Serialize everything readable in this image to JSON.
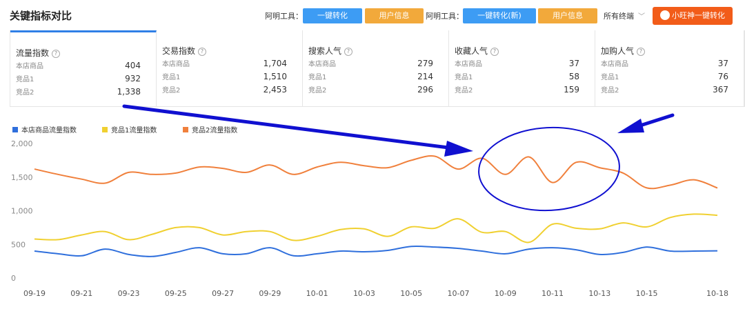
{
  "header": {
    "title": "关键指标对比",
    "tool_label_1": "阿明工具：",
    "btn_convert": "一键转化",
    "btn_user_info_1": "用户信息",
    "tool_label_2": "阿明工具：",
    "btn_convert_new": "一键转化(新)",
    "btn_user_info_2": "用户信息",
    "terminal_select": "所有终端",
    "btn_wangshen": "小旺神一键转化"
  },
  "cards": [
    {
      "title": "流量指数",
      "rows": [
        {
          "label": "本店商品",
          "value": "404"
        },
        {
          "label": "竞品1",
          "value": "932"
        },
        {
          "label": "竞品2",
          "value": "1,338"
        }
      ]
    },
    {
      "title": "交易指数",
      "rows": [
        {
          "label": "本店商品",
          "value": "1,704"
        },
        {
          "label": "竞品1",
          "value": "1,510"
        },
        {
          "label": "竞品2",
          "value": "2,453"
        }
      ]
    },
    {
      "title": "搜索人气",
      "rows": [
        {
          "label": "本店商品",
          "value": "279"
        },
        {
          "label": "竞品1",
          "value": "214"
        },
        {
          "label": "竞品2",
          "value": "296"
        }
      ]
    },
    {
      "title": "收藏人气",
      "rows": [
        {
          "label": "本店商品",
          "value": "37"
        },
        {
          "label": "竞品1",
          "value": "58"
        },
        {
          "label": "竞品2",
          "value": "159"
        }
      ]
    },
    {
      "title": "加购人气",
      "rows": [
        {
          "label": "本店商品",
          "value": "37"
        },
        {
          "label": "竞品1",
          "value": "76"
        },
        {
          "label": "竞品2",
          "value": "367"
        }
      ]
    }
  ],
  "colors": {
    "accent": "#2f7fe6",
    "btn_blue": "#3d9cf4",
    "btn_orange": "#f2a93b",
    "btn_red": "#f25c19",
    "annotation": "#1010d0"
  },
  "icons": {
    "help": "question-circle-icon",
    "wangshen": "wangwang-icon",
    "dropdown": "chevron-down-icon"
  },
  "chart_data": {
    "type": "line",
    "legend_position": "top-left",
    "grid": false,
    "ylim": [
      0,
      2000
    ],
    "yticks": [
      "0",
      "500",
      "1,000",
      "1,500",
      "2,000"
    ],
    "x_labels": [
      "09-19",
      "09-21",
      "09-23",
      "09-25",
      "09-27",
      "09-29",
      "10-01",
      "10-03",
      "10-05",
      "10-07",
      "10-09",
      "10-11",
      "10-13",
      "10-15",
      "10-18"
    ],
    "x": [
      "09-19",
      "09-20",
      "09-21",
      "09-22",
      "09-23",
      "09-24",
      "09-25",
      "09-26",
      "09-27",
      "09-28",
      "09-29",
      "09-30",
      "10-01",
      "10-02",
      "10-03",
      "10-04",
      "10-05",
      "10-06",
      "10-07",
      "10-08",
      "10-09",
      "10-10",
      "10-11",
      "10-12",
      "10-13",
      "10-14",
      "10-15",
      "10-16",
      "10-17",
      "10-18"
    ],
    "series": [
      {
        "name": "本店商品流量指数",
        "color": "#2f6fdc",
        "values": [
          400,
          360,
          330,
          430,
          350,
          320,
          380,
          450,
          360,
          360,
          450,
          330,
          360,
          400,
          390,
          410,
          470,
          460,
          440,
          400,
          360,
          430,
          450,
          420,
          350,
          380,
          460,
          400,
          400,
          404
        ]
      },
      {
        "name": "竞品1流量指数",
        "color": "#f0d030",
        "values": [
          580,
          570,
          640,
          690,
          570,
          650,
          750,
          750,
          640,
          690,
          690,
          560,
          620,
          720,
          730,
          620,
          760,
          740,
          880,
          680,
          690,
          530,
          800,
          740,
          730,
          820,
          760,
          900,
          950,
          932
        ]
      },
      {
        "name": "竞品2流量指数",
        "color": "#f0803c",
        "values": [
          1620,
          1540,
          1470,
          1410,
          1570,
          1540,
          1560,
          1650,
          1630,
          1570,
          1680,
          1540,
          1650,
          1720,
          1670,
          1640,
          1750,
          1810,
          1620,
          1780,
          1540,
          1800,
          1420,
          1720,
          1640,
          1560,
          1340,
          1380,
          1460,
          1338
        ]
      }
    ]
  }
}
